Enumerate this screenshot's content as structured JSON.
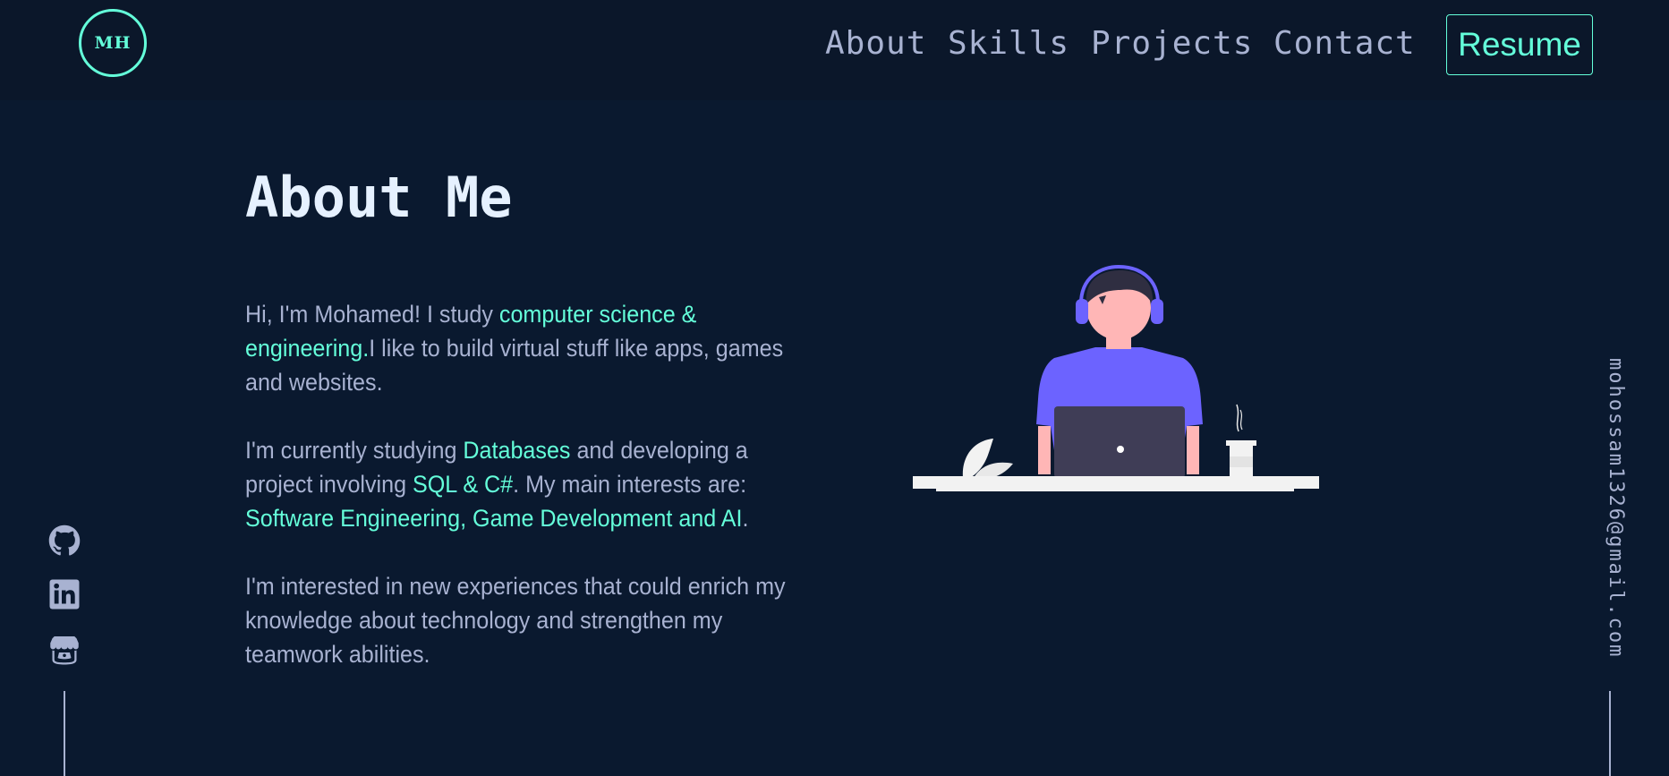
{
  "nav": {
    "logo": "MH",
    "links": [
      "About",
      "Skills",
      "Projects",
      "Contact"
    ],
    "resume_label": "Resume"
  },
  "about": {
    "title": "About Me",
    "p1": {
      "t1": "Hi, I'm Mohamed! I study ",
      "h1": "computer science & engineering.",
      "t2": "I like to build virtual stuff like apps, games and websites."
    },
    "p2": {
      "t1": "I'm currently studying ",
      "h1": "Databases",
      "t2": " and developing a project involving ",
      "h2": "SQL & C#",
      "t3": ". My main interests are: ",
      "h3": "Software Engineering, Game Development and AI",
      "t4": "."
    },
    "p3": "I'm interested in new experiences that could enrich my knowledge about technology and strengthen my teamwork abilities."
  },
  "social": {
    "icons": [
      "github-icon",
      "linkedin-icon",
      "itchio-icon"
    ]
  },
  "email": "mohossam1326@gmail.com",
  "colors": {
    "background": "#0a192f",
    "navbar": "#0b172a",
    "accent": "#64ffda",
    "text": "#a8b2d1",
    "heading": "#e6f1ff",
    "illustration_purple": "#6c63ff"
  }
}
